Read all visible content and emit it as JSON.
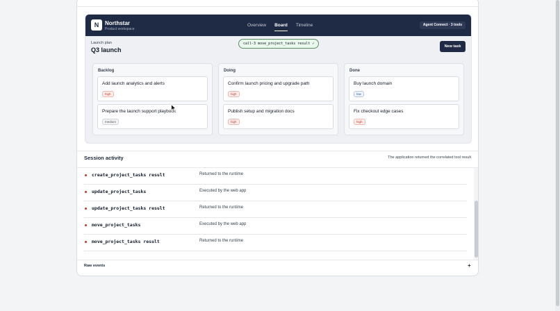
{
  "app": {
    "logo_letter": "N",
    "brand_name": "Northstar",
    "brand_sub": "Product workspace",
    "tabs": [
      {
        "label": "Overview",
        "active": false
      },
      {
        "label": "Board",
        "active": true
      },
      {
        "label": "Timeline",
        "active": false
      }
    ],
    "agent_badge": "Agent Connect · 3 tools",
    "plan_kicker": "Launch plan",
    "plan_title": "Q3 launch",
    "call_pill": "call-3 move_project_tasks result ✓",
    "new_task_label": "New task"
  },
  "board": {
    "columns": [
      {
        "title": "Backlog",
        "cards": [
          {
            "title": "Add launch analytics and alerts",
            "priority": "high"
          },
          {
            "title": "Prepare the launch support playbook",
            "priority": "medium"
          }
        ]
      },
      {
        "title": "Doing",
        "cards": [
          {
            "title": "Confirm launch pricing and upgrade path",
            "priority": "high"
          },
          {
            "title": "Publish setup and migration docs",
            "priority": "high"
          }
        ]
      },
      {
        "title": "Done",
        "cards": [
          {
            "title": "Buy launch domain",
            "priority": "low"
          },
          {
            "title": "Fix checkout edge cases",
            "priority": "high"
          }
        ]
      }
    ]
  },
  "session": {
    "title": "Session activity",
    "note": "The application returned the correlated tool result",
    "events": [
      {
        "name": "create_project_tasks result",
        "desc": "Returned to the runtime"
      },
      {
        "name": "update_project_tasks",
        "desc": "Executed by the web app"
      },
      {
        "name": "update_project_tasks result",
        "desc": "Returned to the runtime"
      },
      {
        "name": "move_project_tasks",
        "desc": "Executed by the web app"
      },
      {
        "name": "move_project_tasks result",
        "desc": "Returned to the runtime"
      }
    ]
  },
  "raw_events": {
    "title": "Raw events",
    "toggle": "+"
  },
  "colors": {
    "header_bg": "#1f2a44",
    "high": "#c0392b",
    "low": "#2e5aa7",
    "pill_border": "#5a8f66"
  }
}
